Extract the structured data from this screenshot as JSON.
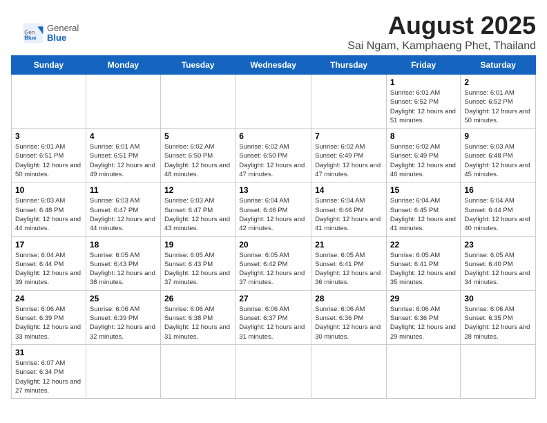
{
  "logo": {
    "general": "General",
    "blue": "Blue"
  },
  "title": "August 2025",
  "subtitle": "Sai Ngam, Kamphaeng Phet, Thailand",
  "weekdays": [
    "Sunday",
    "Monday",
    "Tuesday",
    "Wednesday",
    "Thursday",
    "Friday",
    "Saturday"
  ],
  "weeks": [
    [
      {
        "day": "",
        "info": ""
      },
      {
        "day": "",
        "info": ""
      },
      {
        "day": "",
        "info": ""
      },
      {
        "day": "",
        "info": ""
      },
      {
        "day": "",
        "info": ""
      },
      {
        "day": "1",
        "info": "Sunrise: 6:01 AM\nSunset: 6:52 PM\nDaylight: 12 hours\nand 51 minutes."
      },
      {
        "day": "2",
        "info": "Sunrise: 6:01 AM\nSunset: 6:52 PM\nDaylight: 12 hours\nand 50 minutes."
      }
    ],
    [
      {
        "day": "3",
        "info": "Sunrise: 6:01 AM\nSunset: 6:51 PM\nDaylight: 12 hours\nand 50 minutes."
      },
      {
        "day": "4",
        "info": "Sunrise: 6:01 AM\nSunset: 6:51 PM\nDaylight: 12 hours\nand 49 minutes."
      },
      {
        "day": "5",
        "info": "Sunrise: 6:02 AM\nSunset: 6:50 PM\nDaylight: 12 hours\nand 48 minutes."
      },
      {
        "day": "6",
        "info": "Sunrise: 6:02 AM\nSunset: 6:50 PM\nDaylight: 12 hours\nand 47 minutes."
      },
      {
        "day": "7",
        "info": "Sunrise: 6:02 AM\nSunset: 6:49 PM\nDaylight: 12 hours\nand 47 minutes."
      },
      {
        "day": "8",
        "info": "Sunrise: 6:02 AM\nSunset: 6:49 PM\nDaylight: 12 hours\nand 46 minutes."
      },
      {
        "day": "9",
        "info": "Sunrise: 6:03 AM\nSunset: 6:48 PM\nDaylight: 12 hours\nand 45 minutes."
      }
    ],
    [
      {
        "day": "10",
        "info": "Sunrise: 6:03 AM\nSunset: 6:48 PM\nDaylight: 12 hours\nand 44 minutes."
      },
      {
        "day": "11",
        "info": "Sunrise: 6:03 AM\nSunset: 6:47 PM\nDaylight: 12 hours\nand 44 minutes."
      },
      {
        "day": "12",
        "info": "Sunrise: 6:03 AM\nSunset: 6:47 PM\nDaylight: 12 hours\nand 43 minutes."
      },
      {
        "day": "13",
        "info": "Sunrise: 6:04 AM\nSunset: 6:46 PM\nDaylight: 12 hours\nand 42 minutes."
      },
      {
        "day": "14",
        "info": "Sunrise: 6:04 AM\nSunset: 6:46 PM\nDaylight: 12 hours\nand 41 minutes."
      },
      {
        "day": "15",
        "info": "Sunrise: 6:04 AM\nSunset: 6:45 PM\nDaylight: 12 hours\nand 41 minutes."
      },
      {
        "day": "16",
        "info": "Sunrise: 6:04 AM\nSunset: 6:44 PM\nDaylight: 12 hours\nand 40 minutes."
      }
    ],
    [
      {
        "day": "17",
        "info": "Sunrise: 6:04 AM\nSunset: 6:44 PM\nDaylight: 12 hours\nand 39 minutes."
      },
      {
        "day": "18",
        "info": "Sunrise: 6:05 AM\nSunset: 6:43 PM\nDaylight: 12 hours\nand 38 minutes."
      },
      {
        "day": "19",
        "info": "Sunrise: 6:05 AM\nSunset: 6:43 PM\nDaylight: 12 hours\nand 37 minutes."
      },
      {
        "day": "20",
        "info": "Sunrise: 6:05 AM\nSunset: 6:42 PM\nDaylight: 12 hours\nand 37 minutes."
      },
      {
        "day": "21",
        "info": "Sunrise: 6:05 AM\nSunset: 6:41 PM\nDaylight: 12 hours\nand 36 minutes."
      },
      {
        "day": "22",
        "info": "Sunrise: 6:05 AM\nSunset: 6:41 PM\nDaylight: 12 hours\nand 35 minutes."
      },
      {
        "day": "23",
        "info": "Sunrise: 6:05 AM\nSunset: 6:40 PM\nDaylight: 12 hours\nand 34 minutes."
      }
    ],
    [
      {
        "day": "24",
        "info": "Sunrise: 6:06 AM\nSunset: 6:39 PM\nDaylight: 12 hours\nand 33 minutes."
      },
      {
        "day": "25",
        "info": "Sunrise: 6:06 AM\nSunset: 6:39 PM\nDaylight: 12 hours\nand 32 minutes."
      },
      {
        "day": "26",
        "info": "Sunrise: 6:06 AM\nSunset: 6:38 PM\nDaylight: 12 hours\nand 31 minutes."
      },
      {
        "day": "27",
        "info": "Sunrise: 6:06 AM\nSunset: 6:37 PM\nDaylight: 12 hours\nand 31 minutes."
      },
      {
        "day": "28",
        "info": "Sunrise: 6:06 AM\nSunset: 6:36 PM\nDaylight: 12 hours\nand 30 minutes."
      },
      {
        "day": "29",
        "info": "Sunrise: 6:06 AM\nSunset: 6:36 PM\nDaylight: 12 hours\nand 29 minutes."
      },
      {
        "day": "30",
        "info": "Sunrise: 6:06 AM\nSunset: 6:35 PM\nDaylight: 12 hours\nand 28 minutes."
      }
    ],
    [
      {
        "day": "31",
        "info": "Sunrise: 6:07 AM\nSunset: 6:34 PM\nDaylight: 12 hours\nand 27 minutes."
      },
      {
        "day": "",
        "info": ""
      },
      {
        "day": "",
        "info": ""
      },
      {
        "day": "",
        "info": ""
      },
      {
        "day": "",
        "info": ""
      },
      {
        "day": "",
        "info": ""
      },
      {
        "day": "",
        "info": ""
      }
    ]
  ]
}
